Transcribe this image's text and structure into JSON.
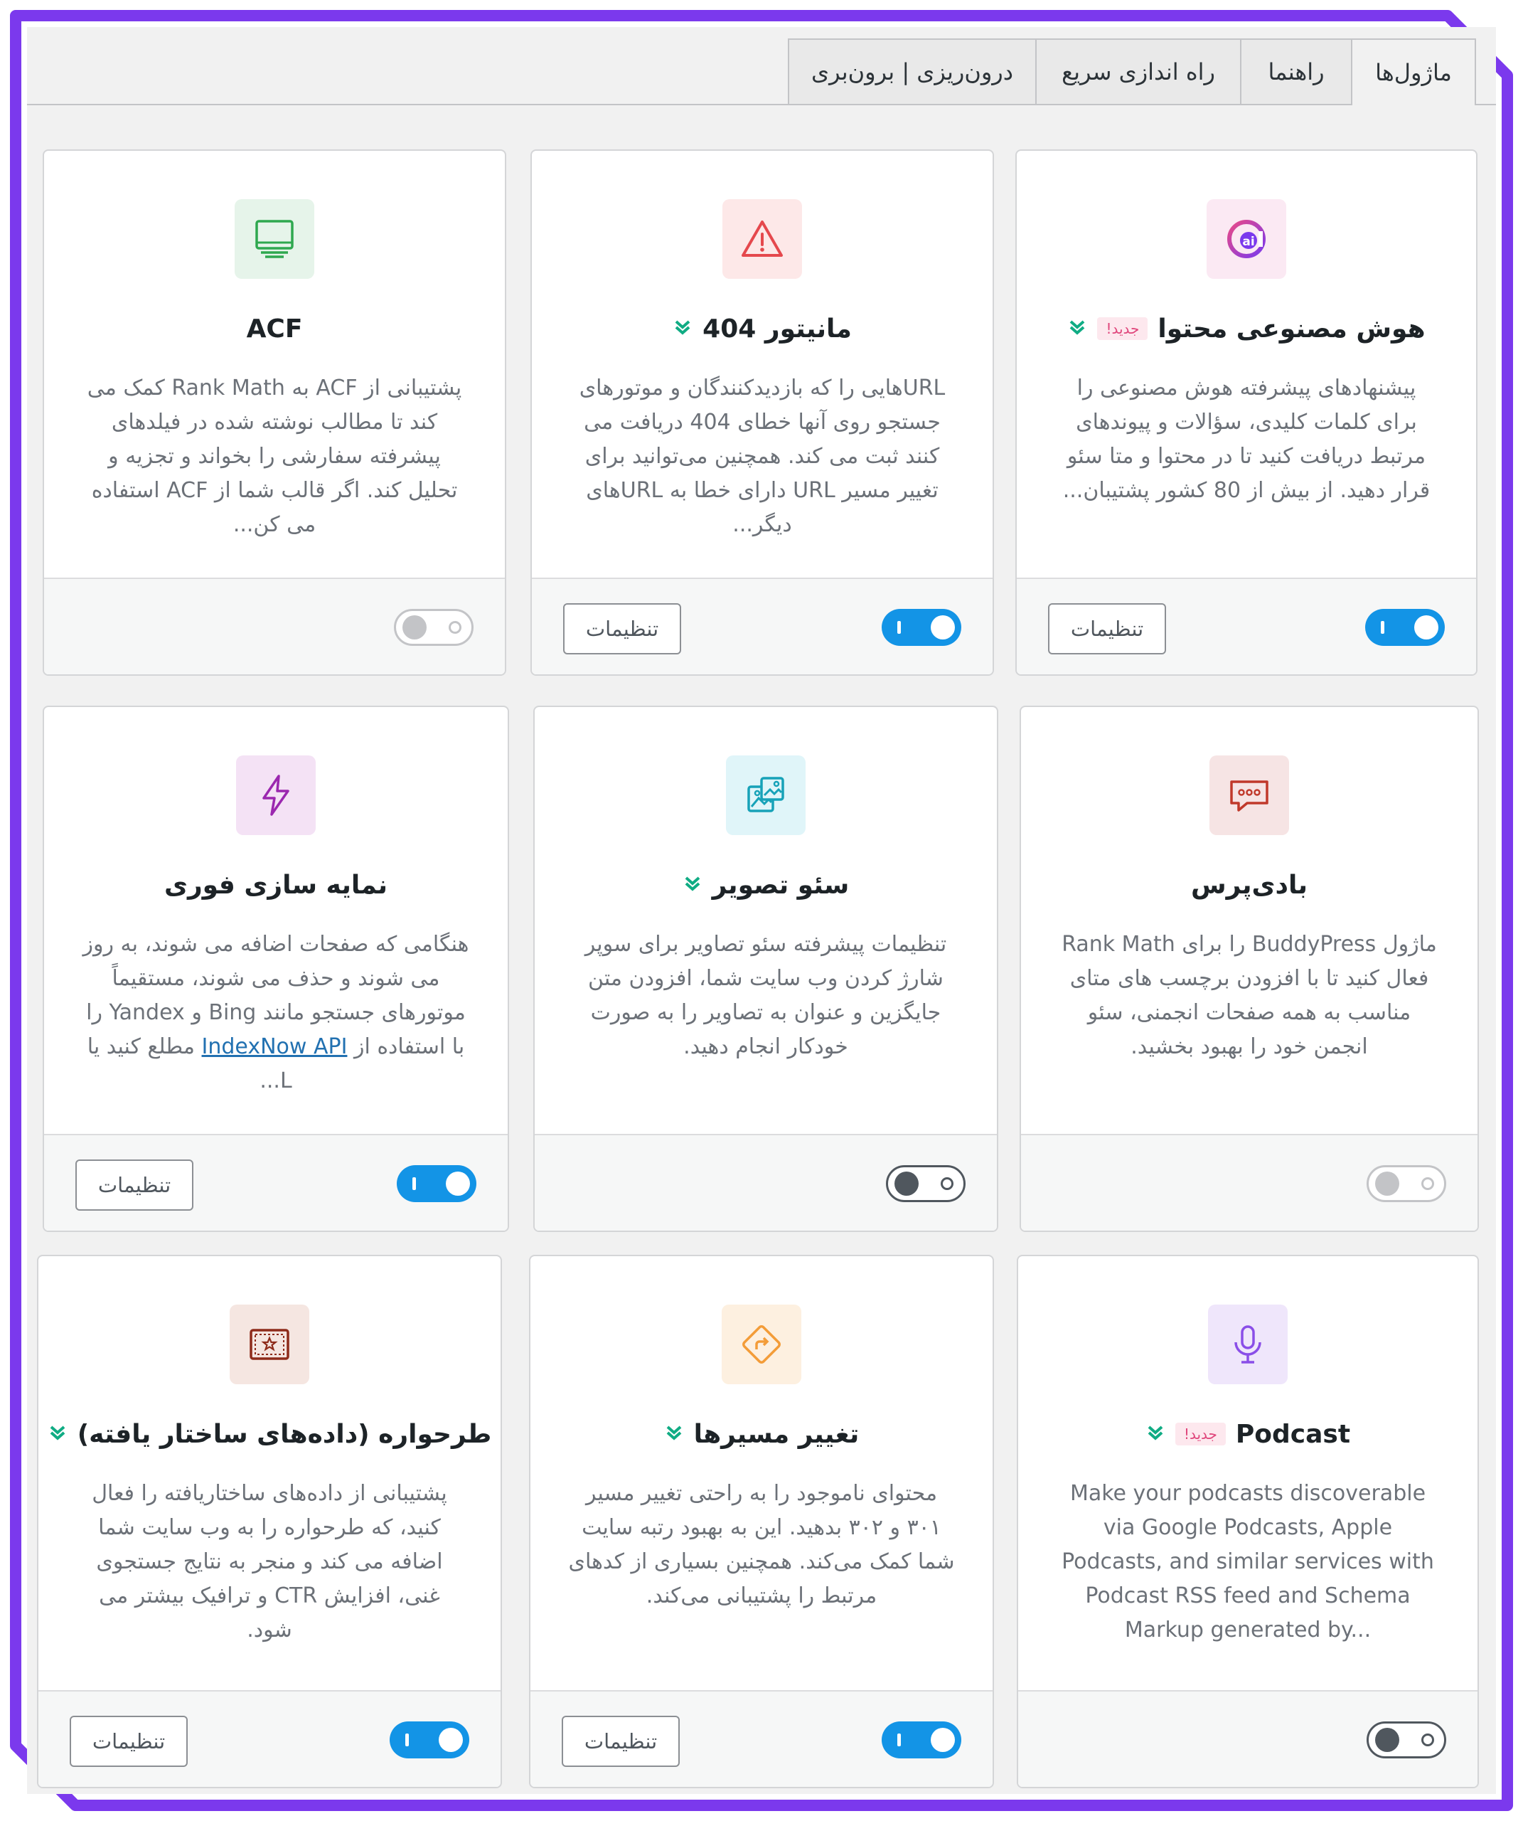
{
  "colors": {
    "frame": "#7b39ed",
    "toggle_on": "#1394e6",
    "badge_new_bg": "#fde8ee",
    "badge_new_text": "#e0457b",
    "chevron_green": "#10ac84",
    "link": "#2271b1"
  },
  "tabs": [
    {
      "label": "ماژول‌ها",
      "active": true
    },
    {
      "label": "راهنما",
      "active": false
    },
    {
      "label": "راه اندازی سریع",
      "active": false
    },
    {
      "label": "درون‌ریزی | برون‌بری",
      "active": false
    }
  ],
  "settings_label": "تنظیمات",
  "modules": {
    "ai": {
      "title": "هوش مصنوعی محتوا",
      "badge": "جدید!",
      "icon": "ai-at-icon",
      "desc": "پیشنهادهای پیشرفته هوش مصنوعی را برای کلمات کلیدی، سؤالات و پیوندهای مرتبط دریافت کنید تا در محتوا و متا سئو قرار دهید. از بیش از 80 کشور پشتیبان...",
      "toggle": "on"
    },
    "monitor": {
      "title": "مانیتور 404",
      "icon": "warning-triangle-icon",
      "desc": "URLهایی را که بازدیدکنندگان و موتورهای جستجو روی آنها خطای 404 دریافت می کنند ثبت می کند. همچنین می‌توانید برای تغییر مسیر URL دارای خطا به URLهای دیگر...",
      "toggle": "on"
    },
    "acf": {
      "title": "ACF",
      "icon": "monitor-screen-icon",
      "desc": "پشتیبانی از ACF به Rank Math کمک می کند تا مطالب نوشته شده در فیلدهای پیشرفته سفارشی را بخواند و تجزیه و تحلیل کند. اگر قالب شما از ACF استفاده می کن...",
      "toggle": "disabled"
    },
    "buddypress": {
      "title": "بادی‌پرس",
      "icon": "chat-dots-icon",
      "desc": "ماژول BuddyPress را برای Rank Math فعال کنید تا با افزودن برچسب های متای مناسب به همه صفحات انجمنی، سئو انجمن خود را بهبود بخشید.",
      "toggle": "disabled"
    },
    "image_seo": {
      "title": "سئو تصویر",
      "icon": "images-icon",
      "desc": "تنظیمات پیشرفته سئو تصاویر برای سوپر شارژ کردن وب سایت شما، افزودن متن جایگزین و عنوان به تصاویر را به صورت خودکار انجام دهید.",
      "toggle": "off"
    },
    "instant_indexing": {
      "title": "نمایه سازی فوری",
      "icon": "lightning-bolt-icon",
      "desc_before": "هنگامی که صفحات اضافه می شوند، به روز می شوند و حذف می شوند، مستقیماً موتورهای جستجو مانند Bing و Yandex را با استفاده از ",
      "desc_link": "IndexNow API",
      "desc_after": " مطلع کنید یا L...",
      "toggle": "on"
    },
    "podcast": {
      "title": "Podcast",
      "badge": "جدید!",
      "icon": "microphone-icon",
      "desc": "Make your podcasts discoverable via Google Podcasts, Apple Podcasts, and similar services with Podcast RSS feed and Schema Markup generated by...",
      "toggle": "off"
    },
    "redirections": {
      "title": "تغییر مسیرها",
      "icon": "redirect-diamond-icon",
      "desc": "محتوای ناموجود را به راحتی تغییر مسیر ۳۰۱ و ۳۰۲ بدهید. این به بهبود رتبه سایت شما کمک می‌کند. همچنین بسیاری از کدهای مرتبط را پشتیبانی می‌کند.",
      "toggle": "on"
    },
    "schema": {
      "title": "طرحواره (داده‌های ساختار یافته)",
      "icon": "schema-certificate-icon",
      "desc": "پشتیبانی از داده‌های ساختاریافته را فعال کنید، که طرحواره را به وب سایت شما اضافه می کند و منجر به نتایج جستجوی غنی، افزایش CTR و ترافیک بیشتر می شود.",
      "toggle": "on"
    }
  }
}
